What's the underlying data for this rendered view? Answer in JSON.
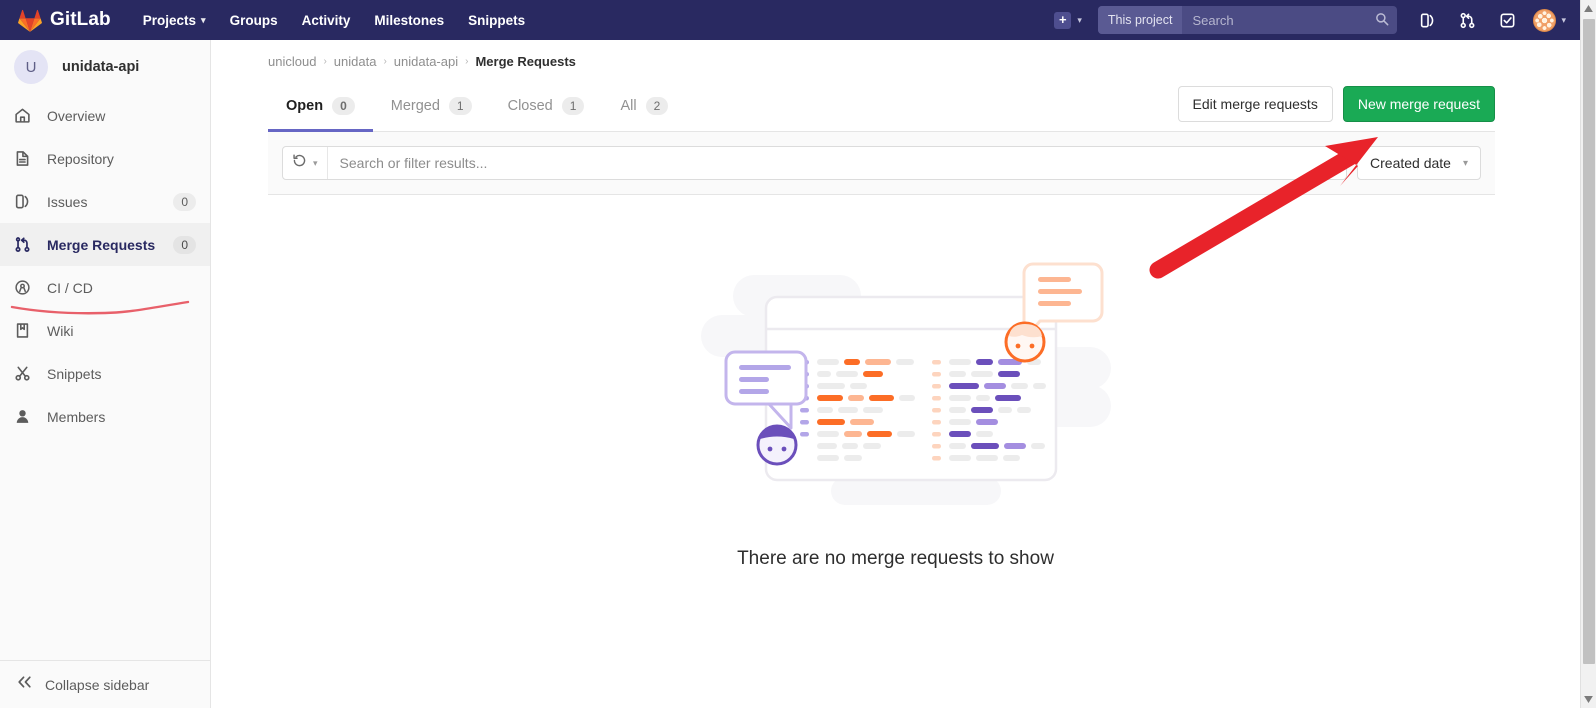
{
  "navbar": {
    "brand": "GitLab",
    "brand_icon": "gitlab-logo-icon",
    "links": [
      {
        "label": "Projects",
        "has_caret": true
      },
      {
        "label": "Groups",
        "has_caret": false
      },
      {
        "label": "Activity",
        "has_caret": false
      },
      {
        "label": "Milestones",
        "has_caret": false
      },
      {
        "label": "Snippets",
        "has_caret": false
      }
    ],
    "create_new_label": "+",
    "search_scope": "This project",
    "search_placeholder": "Search",
    "search_value": "",
    "icons": [
      "issues-icon",
      "merge-requests-icon",
      "todos-done-icon"
    ],
    "avatar_label": "user-avatar"
  },
  "sidebar": {
    "project_initial": "U",
    "project_name": "unidata-api",
    "items": [
      {
        "label": "Overview",
        "icon": "home-icon",
        "count": "",
        "active": false
      },
      {
        "label": "Repository",
        "icon": "document-icon",
        "count": "",
        "active": false
      },
      {
        "label": "Issues",
        "icon": "issues-icon",
        "count": "0",
        "active": false
      },
      {
        "label": "Merge Requests",
        "icon": "merge-request-icon",
        "count": "0",
        "active": true
      },
      {
        "label": "CI / CD",
        "icon": "rocket-icon",
        "count": "",
        "active": false
      },
      {
        "label": "Wiki",
        "icon": "book-icon",
        "count": "",
        "active": false
      },
      {
        "label": "Snippets",
        "icon": "scissors-icon",
        "count": "",
        "active": false
      },
      {
        "label": "Members",
        "icon": "user-icon",
        "count": "",
        "active": false
      }
    ],
    "collapse_label": "Collapse sidebar",
    "collapse_icon": "double-chevron-left-icon"
  },
  "breadcrumb": {
    "items": [
      "unicloud",
      "unidata",
      "unidata-api",
      "Merge Requests"
    ],
    "separator": "›"
  },
  "tabs": [
    {
      "label": "Open",
      "count": "0",
      "active": true
    },
    {
      "label": "Merged",
      "count": "1",
      "active": false
    },
    {
      "label": "Closed",
      "count": "1",
      "active": false
    },
    {
      "label": "All",
      "count": "2",
      "active": false
    }
  ],
  "actions": {
    "edit_label": "Edit merge requests",
    "new_label": "New merge request"
  },
  "filter_bar": {
    "recent_icon": "history-icon",
    "recent_caret": "⌄",
    "placeholder": "Search or filter results...",
    "value": "",
    "sort_label": "Created date",
    "sort_caret": "⌄"
  },
  "empty_state": {
    "title": "There are no merge requests to show",
    "illustration": "merge-requests-empty-illustration"
  },
  "annotation": {
    "arrow_color": "#e8232a",
    "underline_color": "#e8606a",
    "arrow_name": "red-arrow-pointing-to-new-merge-request",
    "underline_name": "red-underline-under-merge-requests"
  },
  "colors": {
    "navbar_bg": "#292961",
    "primary_green": "#1aaa55",
    "tab_active_underline": "#6666c4",
    "sidebar_bg": "#fafafa"
  },
  "scrollbar": {
    "up_arrow": "▲",
    "down_arrow": "▼"
  }
}
